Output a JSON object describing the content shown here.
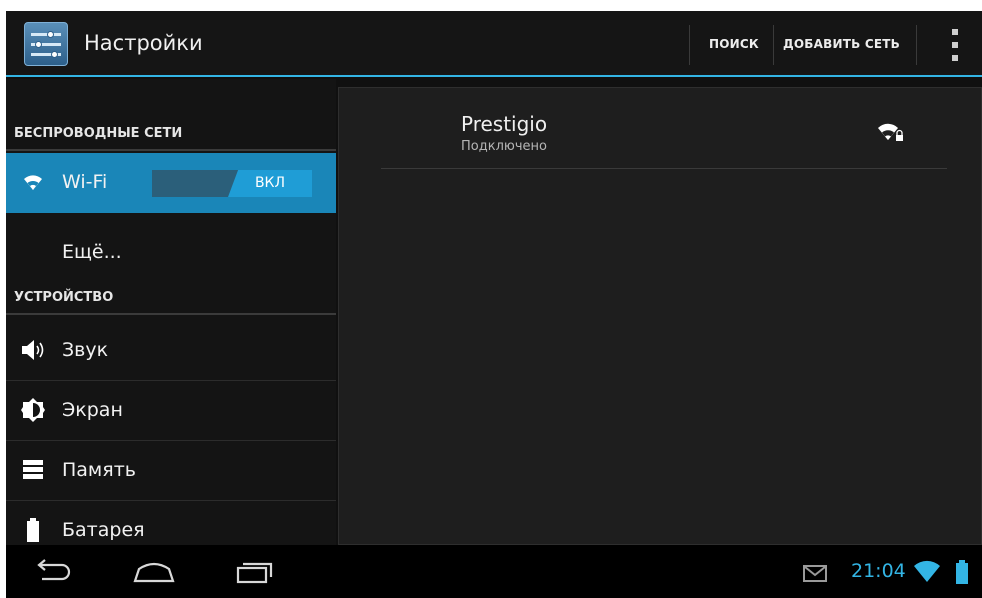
{
  "actionbar": {
    "title": "Настройки",
    "search_label": "ПОИСК",
    "add_network_label": "ДОБАВИТЬ СЕТЬ"
  },
  "sidebar": {
    "sections": [
      {
        "header": "БЕСПРОВОДНЫЕ СЕТИ",
        "items": [
          {
            "label": "Wi-Fi",
            "icon": "wifi-icon",
            "toggle": "ВКЛ",
            "active": true
          },
          {
            "label": "Ещё...",
            "icon": ""
          }
        ]
      },
      {
        "header": "УСТРОЙСТВО",
        "items": [
          {
            "label": "Звук",
            "icon": "speaker-icon"
          },
          {
            "label": "Экран",
            "icon": "brightness-icon"
          },
          {
            "label": "Память",
            "icon": "storage-icon"
          },
          {
            "label": "Батарея",
            "icon": "battery-icon"
          }
        ]
      }
    ]
  },
  "networks": [
    {
      "name": "Prestigio",
      "status": "Подключено",
      "icon": "wifi-locked-icon"
    }
  ],
  "statusbar": {
    "time": "21:04",
    "icons": [
      "gmail-icon",
      "wifi-signal-icon",
      "battery-icon"
    ]
  },
  "navbar": {
    "buttons": [
      "back-icon",
      "home-icon",
      "recent-apps-icon"
    ]
  },
  "colors": {
    "accent": "#33b5e5",
    "active_item": "#1a86b8",
    "toggle_on": "#1f9dd6"
  }
}
